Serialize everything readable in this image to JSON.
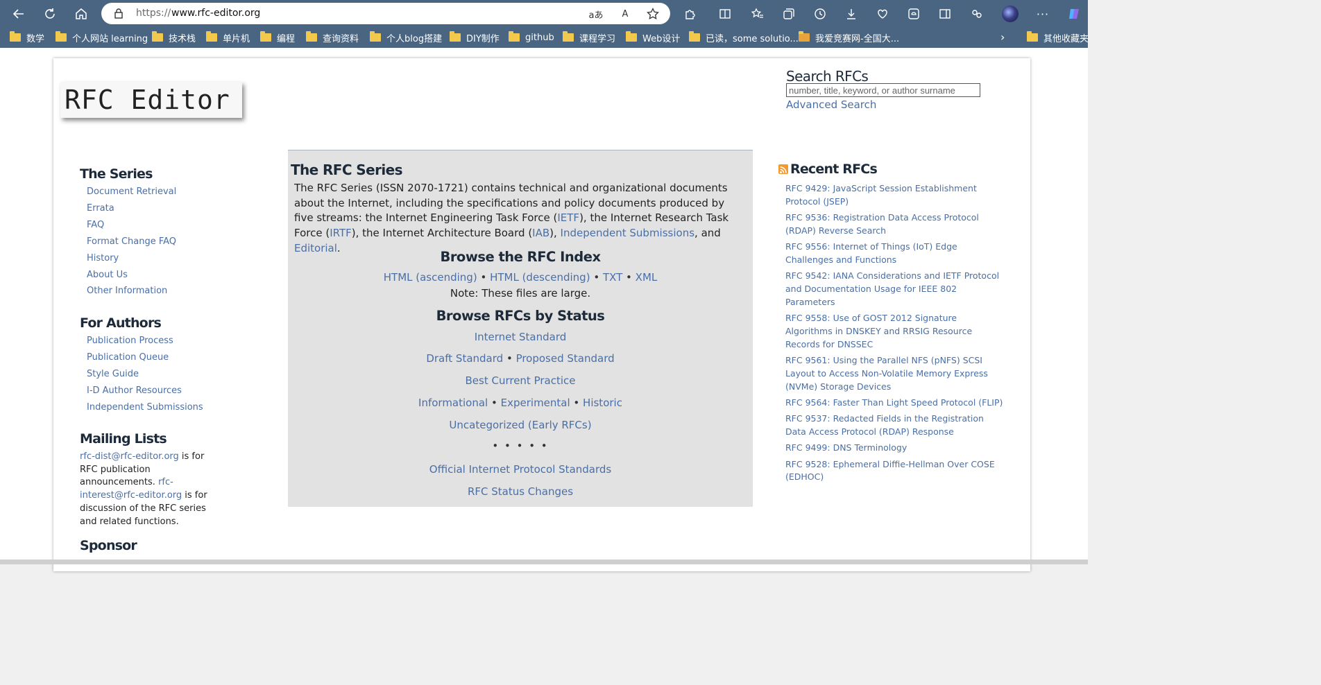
{
  "browser": {
    "url_prefix": "https://",
    "url_host": "www.rfc-editor.org",
    "translate_glyph": "aあ",
    "read_aloud_glyph": "A",
    "more_glyph": "···"
  },
  "bookmarks": {
    "items": [
      "数学",
      "个人网站 learning",
      "技术栈",
      "单片机",
      "编程",
      "查询资料",
      "个人blog搭建",
      "DIY制作",
      "github",
      "课程学习",
      "Web设计",
      "已读，some solutio...",
      "我爱竞赛网-全国大..."
    ],
    "other": "其他收藏夹",
    "chevron": "›"
  },
  "site": {
    "logo": "RFC Editor",
    "search": {
      "title": "Search RFCs",
      "placeholder": "number, title, keyword, or author surname",
      "advanced": "Advanced Search"
    }
  },
  "nav": {
    "series": {
      "heading": "The Series",
      "links": [
        "Document Retrieval",
        "Errata",
        "FAQ",
        "Format Change FAQ",
        "History",
        "About Us",
        "Other Information"
      ]
    },
    "authors": {
      "heading": "For Authors",
      "links": [
        "Publication Process",
        "Publication Queue",
        "Style Guide",
        "I-D Author Resources",
        "Independent Submissions"
      ]
    },
    "mailing": {
      "heading": "Mailing Lists",
      "dist": "rfc-dist@rfc-editor.org",
      "dist_text": " is for RFC publication announcements. ",
      "interest": "rfc-interest@rfc-editor.org",
      "interest_text": " is for discussion of the RFC series and related functions."
    },
    "sponsor": {
      "heading": "Sponsor"
    }
  },
  "main": {
    "title": "The RFC Series",
    "desc": {
      "p1": "The RFC Series (ISSN 2070-1721) contains technical and organizational documents about the Internet, including the specifications and policy documents produced by five streams: the Internet Engineering Task Force (",
      "ietf": "IETF",
      "p2": "), the Internet Research Task Force (",
      "irtf": "IRTF",
      "p3": "), the Internet Architecture Board (",
      "iab": "IAB",
      "p4": "), ",
      "indep": "Independent Submissions",
      "p5": ", and ",
      "editorial": "Editorial",
      "p6": "."
    },
    "index": {
      "heading": "Browse the RFC Index",
      "html_asc": "HTML (ascending)",
      "html_desc": "HTML (descending)",
      "txt": "TXT",
      "xml": "XML",
      "note": "Note: These files are large."
    },
    "status": {
      "heading": "Browse RFCs by Status",
      "internet_standard": "Internet Standard",
      "draft_standard": "Draft Standard",
      "proposed_standard": "Proposed Standard",
      "bcp": "Best Current Practice",
      "informational": "Informational",
      "experimental": "Experimental",
      "historic": "Historic",
      "uncategorized": "Uncategorized (Early RFCs)",
      "dots": "• • • • •",
      "official": "Official Internet Protocol Standards",
      "changes": "RFC Status Changes"
    },
    "bullet": " • "
  },
  "recent": {
    "title": "Recent RFCs",
    "items": [
      "RFC 9429: JavaScript Session Establishment Protocol (JSEP)",
      "RFC 9536: Registration Data Access Protocol (RDAP) Reverse Search",
      "RFC 9556: Internet of Things (IoT) Edge Challenges and Functions",
      "RFC 9542: IANA Considerations and IETF Protocol and Documentation Usage for IEEE 802 Parameters",
      "RFC 9558: Use of GOST 2012 Signature Algorithms in DNSKEY and RRSIG Resource Records for DNSSEC",
      "RFC 9561: Using the Parallel NFS (pNFS) SCSI Layout to Access Non-Volatile Memory Express (NVMe) Storage Devices",
      "RFC 9564: Faster Than Light Speed Protocol (FLIP)",
      "RFC 9537: Redacted Fields in the Registration Data Access Protocol (RDAP) Response",
      "RFC 9499: DNS Terminology",
      "RFC 9528: Ephemeral Diffie-Hellman Over COSE (EDHOC)"
    ]
  },
  "colors": {
    "chrome": "#4a6582",
    "link": "#4a6fa5",
    "heading": "#1d2a3a",
    "panel": "#e2e2e2"
  }
}
